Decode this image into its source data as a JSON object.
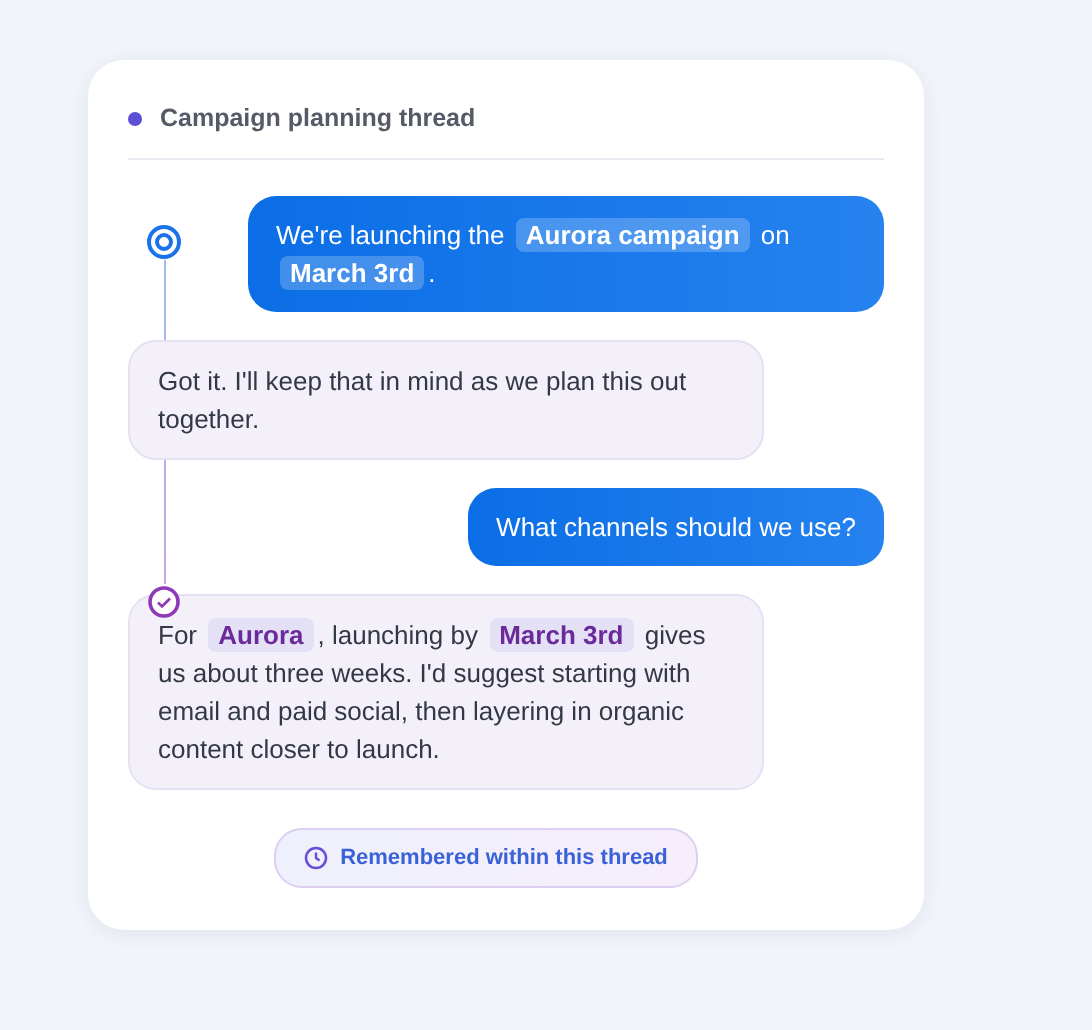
{
  "thread": {
    "title": "Campaign planning thread"
  },
  "messages": [
    {
      "kind": "user",
      "thread_start": true,
      "text": "We're launching the **Aurora campaign** on **March 3rd**."
    },
    {
      "kind": "assistant",
      "text": "Got it. I'll keep that in mind as we plan this out together."
    },
    {
      "kind": "user",
      "text": "What channels should we use?"
    },
    {
      "kind": "assistant",
      "memory_used": true,
      "text": "For **Aurora**, launching by **March 3rd** gives us about three weeks. I'd suggest starting with email and paid social, then layering in organic content closer to launch."
    }
  ],
  "memory_badge": "Remembered within this thread"
}
